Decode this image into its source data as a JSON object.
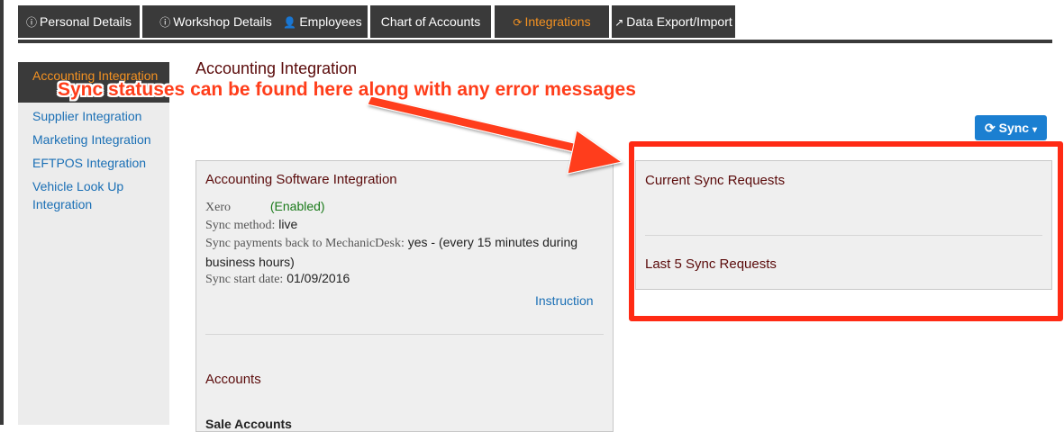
{
  "tabs": [
    {
      "label": "Personal Details",
      "icon": "info-icon"
    },
    {
      "label": "Workshop Details",
      "icon": "info-icon"
    },
    {
      "label": "Employees",
      "icon": "user-icon"
    },
    {
      "label": "Chart of Accounts",
      "icon": ""
    },
    {
      "label": "Integrations",
      "icon": "refresh-icon",
      "active": true
    },
    {
      "label": "Data Export/Import",
      "icon": "external-link-icon"
    }
  ],
  "sidebar": {
    "active_label": "Accounting Integration",
    "items": [
      {
        "label": "Supplier Integration"
      },
      {
        "label": "Marketing Integration"
      },
      {
        "label": "EFTPOS Integration"
      },
      {
        "label": "Vehicle Look Up Integration"
      }
    ]
  },
  "main": {
    "title": "Accounting Integration",
    "sync_button": {
      "label": "Sync",
      "icon": "refresh-icon",
      "caret": "caret-down-icon"
    }
  },
  "accounting_panel": {
    "title": "Accounting Software Integration",
    "provider_label": "Xero",
    "provider_status": "(Enabled)",
    "sync_method_label": "Sync method:",
    "sync_method_value": "live",
    "sync_payments_label": "Sync payments back to MechanicDesk:",
    "sync_payments_value": "yes - (every 15 minutes during business hours)",
    "sync_start_label": "Sync start date:",
    "sync_start_value": "01/09/2016",
    "instruction_link": "Instruction",
    "accounts_heading": "Accounts",
    "sale_accounts_heading": "Sale Accounts"
  },
  "sync_panel": {
    "current_heading": "Current Sync Requests",
    "last5_heading": "Last 5 Sync Requests"
  },
  "annotation": {
    "text": "Sync statuses can be found here along with any error messages",
    "color": "#ff3d1a"
  },
  "colors": {
    "tab_bg": "#3a3a3a",
    "active_accent": "#f39121",
    "link": "#1a6fb5",
    "heading": "#5a0a0a",
    "button": "#1b7fd1",
    "highlight": "#ff2a14"
  }
}
